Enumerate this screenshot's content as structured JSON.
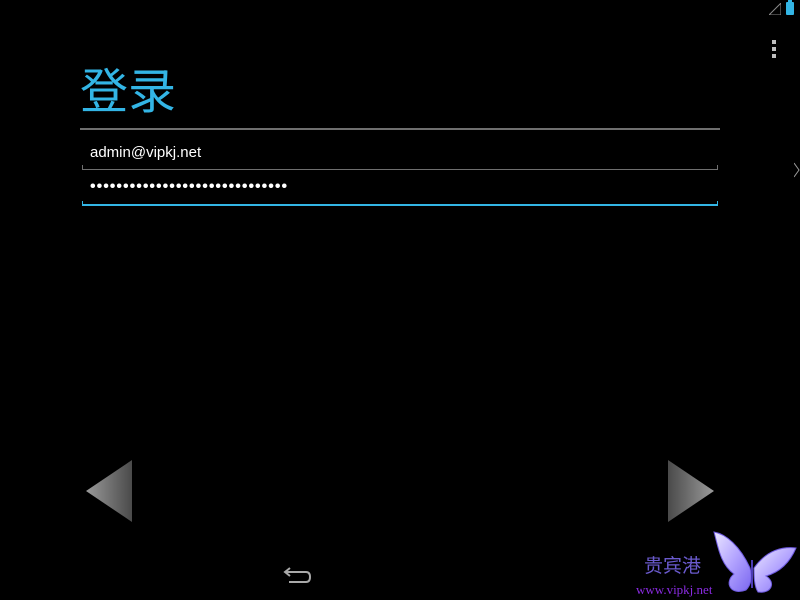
{
  "status_bar": {
    "icons": [
      "signal-icon",
      "battery-icon"
    ]
  },
  "menu": {
    "icon": "overflow-menu-icon"
  },
  "title": "登录",
  "form": {
    "email_value": "admin@vipkj.net",
    "password_mask": "••••••••••••••••••••••••••••••"
  },
  "navigation": {
    "prev_icon": "arrow-left-icon",
    "next_icon": "arrow-right-icon",
    "back_icon": "back-icon"
  },
  "watermark": {
    "title": "贵宾港",
    "url": "www.vipkj.net"
  },
  "colors": {
    "accent": "#33b5e5",
    "background": "#000000",
    "divider": "#6f6f6f",
    "watermark_text": "#6a5acd",
    "watermark_url": "#8a2be2"
  }
}
